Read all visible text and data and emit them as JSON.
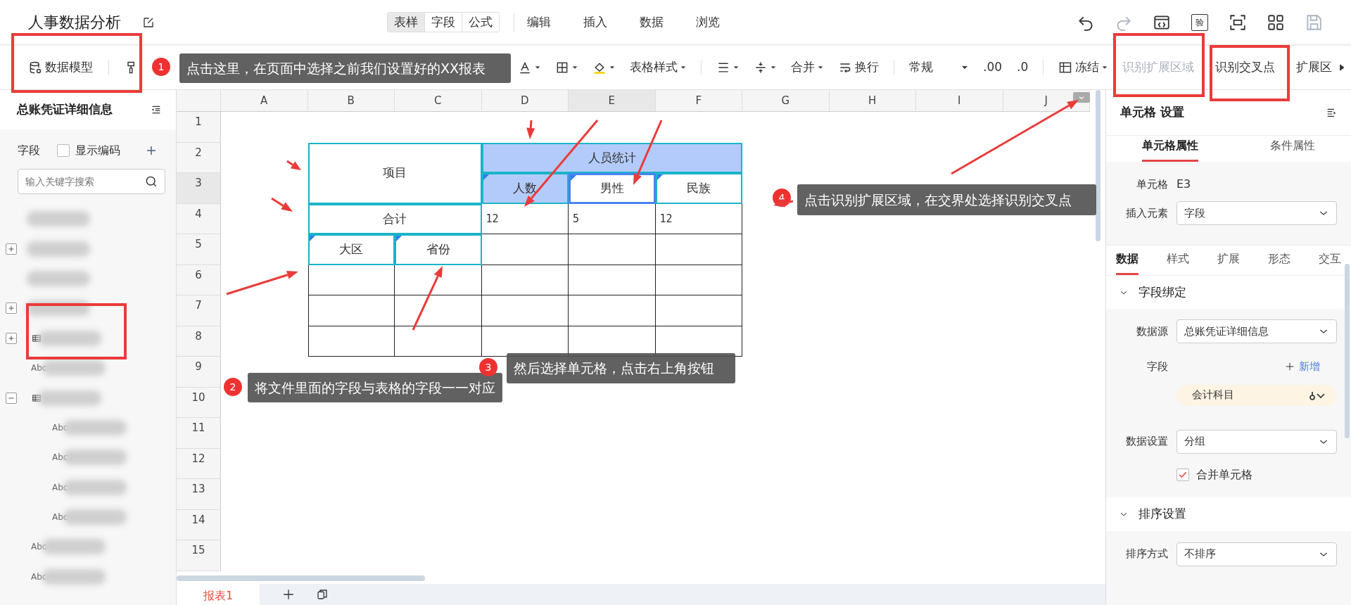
{
  "app": {
    "title": "人事数据分析"
  },
  "view_tabs": [
    {
      "label": "表样",
      "selected": true
    },
    {
      "label": "字段",
      "selected": false
    },
    {
      "label": "公式",
      "selected": false
    }
  ],
  "menu": [
    {
      "label": "编辑"
    },
    {
      "label": "插入"
    },
    {
      "label": "数据"
    },
    {
      "label": "浏览"
    }
  ],
  "header_icons": [
    {
      "kind": "undo",
      "disabled": false
    },
    {
      "kind": "redo",
      "disabled": true
    },
    {
      "kind": "code",
      "disabled": false
    },
    {
      "kind": "verify",
      "label": "验",
      "disabled": false
    },
    {
      "kind": "scan",
      "disabled": false
    },
    {
      "kind": "apps",
      "disabled": false
    },
    {
      "kind": "save",
      "disabled": true
    }
  ],
  "toolbar_left": [
    {
      "kind": "database",
      "label": "数据模型",
      "disabled": false
    },
    {
      "kind": "divider"
    },
    {
      "kind": "brush"
    }
  ],
  "toolbar_right": [
    {
      "kind": "fontcolor",
      "caret": true
    },
    {
      "kind": "border",
      "caret": true
    },
    {
      "kind": "fill",
      "caret": true
    },
    {
      "kind": "button",
      "label": "表格样式",
      "caret": true,
      "disabled": false
    },
    {
      "kind": "divider"
    },
    {
      "kind": "align",
      "caret": true
    },
    {
      "kind": "valign",
      "caret": true
    },
    {
      "kind": "button",
      "label": "合并",
      "caret": true,
      "disabled": false
    },
    {
      "kind": "wrap",
      "label": "换行",
      "disabled": false
    },
    {
      "kind": "divider"
    },
    {
      "kind": "select",
      "label": "常规"
    },
    {
      "kind": "button",
      "label": ".00",
      "disabled": false
    },
    {
      "kind": "button",
      "label": ".0",
      "disabled": false
    },
    {
      "kind": "divider"
    },
    {
      "kind": "freeze",
      "label": "冻结",
      "caret": true,
      "disabled": false
    },
    {
      "kind": "button",
      "label": "识别扩展区域",
      "disabled": true
    },
    {
      "kind": "button",
      "label": "识别交叉点",
      "disabled": false
    },
    {
      "kind": "button",
      "label": "扩展区",
      "disabled": false
    },
    {
      "kind": "next"
    }
  ],
  "sidebar": {
    "title": "总账凭证详细信息",
    "field_label": "字段",
    "show_code": {
      "label": "显示编码",
      "checked": false
    },
    "search": {
      "placeholder": "输入关键字搜索"
    },
    "tree": [
      {
        "kind": "item"
      },
      {
        "kind": "item",
        "expanded": false
      },
      {
        "kind": "item"
      },
      {
        "kind": "item",
        "expanded": false
      },
      {
        "kind": "table",
        "expanded": false
      },
      {
        "kind": "field",
        "type_label": "Abc"
      },
      {
        "kind": "table",
        "expanded": true,
        "children": [
          {
            "kind": "field",
            "type_label": "Abc"
          },
          {
            "kind": "field",
            "type_label": "Abc"
          },
          {
            "kind": "field",
            "type_label": "Abc"
          },
          {
            "kind": "field",
            "type_label": "Abc"
          }
        ]
      },
      {
        "kind": "field",
        "type_label": "Abc"
      },
      {
        "kind": "field",
        "type_label": "Abc"
      }
    ]
  },
  "sheet": {
    "columns": [
      "A",
      "B",
      "C",
      "D",
      "E",
      "F",
      "G",
      "H",
      "I",
      "J"
    ],
    "rows": [
      "1",
      "2",
      "3",
      "4",
      "5",
      "6",
      "7",
      "8",
      "9",
      "10",
      "11",
      "12",
      "13",
      "14",
      "15"
    ],
    "report": {
      "rows": [
        [
          {
            "text": "项目",
            "kind": "header",
            "selected": false
          },
          {
            "merged": true
          },
          {
            "text": "人员统计",
            "kind": "header",
            "fill": true,
            "selected": false
          },
          {
            "merged": true
          },
          {
            "merged": true
          }
        ],
        [
          {
            "merged": true
          },
          {
            "merged": true
          },
          {
            "text": "人数",
            "kind": "header",
            "fill": true,
            "flag": true,
            "selected": false
          },
          {
            "text": "男性",
            "kind": "header",
            "flag": true,
            "selected": true
          },
          {
            "text": "民族",
            "kind": "header",
            "flag": true,
            "selected": false
          }
        ],
        [
          {
            "text": "合计",
            "kind": "header",
            "selected": false
          },
          {
            "merged": true
          },
          {
            "text": "12",
            "kind": "value",
            "selected": false
          },
          {
            "text": "5",
            "kind": "value",
            "selected": false
          },
          {
            "text": "12",
            "kind": "value",
            "selected": false
          }
        ],
        [
          {
            "text": "大区",
            "kind": "header",
            "flag": true,
            "selected": false
          },
          {
            "text": "省份",
            "kind": "header",
            "flag": true,
            "selected": false
          },
          {
            "selected": false
          },
          {
            "selected": false
          },
          {
            "selected": false
          }
        ],
        [
          {
            "selected": false
          },
          {
            "selected": false
          },
          {
            "selected": false
          },
          {
            "selected": false
          },
          {
            "selected": false
          }
        ],
        [
          {
            "selected": false
          },
          {
            "selected": false
          },
          {
            "selected": false
          },
          {
            "selected": false
          },
          {
            "selected": false
          }
        ],
        [
          {
            "selected": false
          },
          {
            "selected": false
          },
          {
            "selected": false
          },
          {
            "selected": false
          },
          {
            "selected": false
          }
        ]
      ]
    },
    "sheet_tabs": [
      {
        "label": "报表1",
        "selected": true
      }
    ]
  },
  "panel": {
    "title": "单元格 设置",
    "tabs": [
      {
        "label": "单元格属性",
        "selected": true
      },
      {
        "label": "条件属性",
        "selected": false
      }
    ],
    "cell": {
      "label": "单元格",
      "value": "E3"
    },
    "insert": {
      "label": "插入元素",
      "value": "字段"
    },
    "subtabs": [
      {
        "label": "数据",
        "selected": true
      },
      {
        "label": "样式",
        "selected": false
      },
      {
        "label": "扩展",
        "selected": false
      },
      {
        "label": "形态",
        "selected": false
      },
      {
        "label": "交互",
        "selected": false
      }
    ],
    "binding": {
      "title": "字段绑定",
      "expanded": true,
      "source": {
        "label": "数据源",
        "value": "总账凭证详细信息"
      },
      "field": {
        "label": "字段",
        "add": "新增",
        "chips": [
          {
            "label": "会计科目"
          }
        ]
      },
      "data_setting": {
        "label": "数据设置",
        "value": "分组"
      },
      "merge": {
        "label": "合并单元格",
        "checked": true
      }
    },
    "sort": {
      "title": "排序设置",
      "expanded": true,
      "mode": {
        "label": "排序方式",
        "value": "不排序"
      }
    }
  },
  "callouts": [
    {
      "number": "1",
      "text": "点击这里，在页面中选择之前我们设置好的XX报表"
    },
    {
      "number": "2",
      "text": "将文件里面的字段与表格的字段一一对应"
    },
    {
      "number": "3",
      "text": "然后选择单元格，点击右上角按钮"
    },
    {
      "number": "4",
      "text": "点击识别扩展区域，在交界处选择识别交叉点"
    }
  ]
}
